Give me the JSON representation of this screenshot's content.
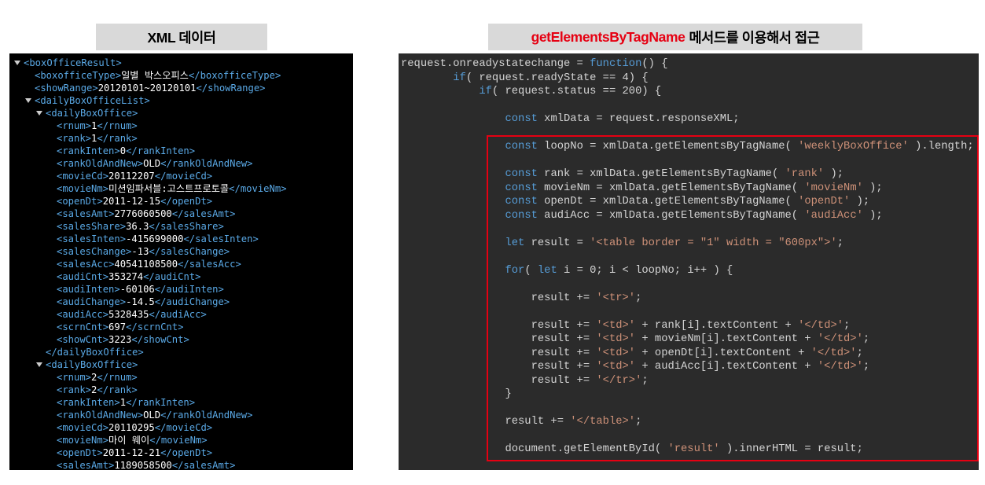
{
  "colors": {
    "header_bg": "#d9d9d9",
    "title_accent": "#e60012",
    "xml_bg": "#000000",
    "xml_tag": "#5aa9e6",
    "xml_text": "#ffffff",
    "xml_toggle": "#cccccc",
    "code_bg": "#2b2b2b",
    "code_text": "#d4d4d4",
    "code_keyword": "#569cd6",
    "code_string": "#ce9178",
    "highlight_border": "#e60012"
  },
  "xml_panel": {
    "title": "XML 데이터",
    "toggle_icon": "collapse-triangle-icon",
    "lines": [
      {
        "depth": 0,
        "toggle": true,
        "open": "<boxOfficeResult>"
      },
      {
        "depth": 1,
        "open": "<boxofficeType>",
        "value": "일별 박스오피스",
        "close": "</boxofficeType>"
      },
      {
        "depth": 1,
        "open": "<showRange>",
        "value": "20120101~20120101",
        "close": "</showRange>"
      },
      {
        "depth": 1,
        "toggle": true,
        "open": "<dailyBoxOfficeList>"
      },
      {
        "depth": 2,
        "toggle": true,
        "open": "<dailyBoxOffice>"
      },
      {
        "depth": 3,
        "open": "<rnum>",
        "value": "1",
        "close": "</rnum>"
      },
      {
        "depth": 3,
        "open": "<rank>",
        "value": "1",
        "close": "</rank>"
      },
      {
        "depth": 3,
        "open": "<rankInten>",
        "value": "0",
        "close": "</rankInten>"
      },
      {
        "depth": 3,
        "open": "<rankOldAndNew>",
        "value": "OLD",
        "close": "</rankOldAndNew>"
      },
      {
        "depth": 3,
        "open": "<movieCd>",
        "value": "20112207",
        "close": "</movieCd>"
      },
      {
        "depth": 3,
        "open": "<movieNm>",
        "value": "미션임파서블:고스트프로토콜",
        "close": "</movieNm>"
      },
      {
        "depth": 3,
        "open": "<openDt>",
        "value": "2011-12-15",
        "close": "</openDt>"
      },
      {
        "depth": 3,
        "open": "<salesAmt>",
        "value": "2776060500",
        "close": "</salesAmt>"
      },
      {
        "depth": 3,
        "open": "<salesShare>",
        "value": "36.3",
        "close": "</salesShare>"
      },
      {
        "depth": 3,
        "open": "<salesInten>",
        "value": "-415699000",
        "close": "</salesInten>"
      },
      {
        "depth": 3,
        "open": "<salesChange>",
        "value": "-13",
        "close": "</salesChange>"
      },
      {
        "depth": 3,
        "open": "<salesAcc>",
        "value": "40541108500",
        "close": "</salesAcc>"
      },
      {
        "depth": 3,
        "open": "<audiCnt>",
        "value": "353274",
        "close": "</audiCnt>"
      },
      {
        "depth": 3,
        "open": "<audiInten>",
        "value": "-60106",
        "close": "</audiInten>"
      },
      {
        "depth": 3,
        "open": "<audiChange>",
        "value": "-14.5",
        "close": "</audiChange>"
      },
      {
        "depth": 3,
        "open": "<audiAcc>",
        "value": "5328435",
        "close": "</audiAcc>"
      },
      {
        "depth": 3,
        "open": "<scrnCnt>",
        "value": "697",
        "close": "</scrnCnt>"
      },
      {
        "depth": 3,
        "open": "<showCnt>",
        "value": "3223",
        "close": "</showCnt>"
      },
      {
        "depth": 2,
        "close": "</dailyBoxOffice>"
      },
      {
        "depth": 2,
        "toggle": true,
        "open": "<dailyBoxOffice>"
      },
      {
        "depth": 3,
        "open": "<rnum>",
        "value": "2",
        "close": "</rnum>"
      },
      {
        "depth": 3,
        "open": "<rank>",
        "value": "2",
        "close": "</rank>"
      },
      {
        "depth": 3,
        "open": "<rankInten>",
        "value": "1",
        "close": "</rankInten>"
      },
      {
        "depth": 3,
        "open": "<rankOldAndNew>",
        "value": "OLD",
        "close": "</rankOldAndNew>"
      },
      {
        "depth": 3,
        "open": "<movieCd>",
        "value": "20110295",
        "close": "</movieCd>"
      },
      {
        "depth": 3,
        "open": "<movieNm>",
        "value": "마이 웨이",
        "close": "</movieNm>"
      },
      {
        "depth": 3,
        "open": "<openDt>",
        "value": "2011-12-21",
        "close": "</openDt>"
      },
      {
        "depth": 3,
        "open": "<salesAmt>",
        "value": "1189058500",
        "close": "</salesAmt>"
      }
    ]
  },
  "code_panel": {
    "title_method": "getElementsByTagName",
    "title_rest": "메서드를 이용해서 접근",
    "lines": [
      [
        {
          "t": "request.onreadystatechange = "
        },
        {
          "t": "function",
          "color": "#569cd6"
        },
        {
          "t": "() {"
        }
      ],
      [
        {
          "t": "        "
        },
        {
          "t": "if",
          "color": "#569cd6"
        },
        {
          "t": "( request.readyState == 4) {"
        }
      ],
      [
        {
          "t": "            "
        },
        {
          "t": "if",
          "color": "#569cd6"
        },
        {
          "t": "( request.status == 200) {"
        }
      ],
      [],
      [
        {
          "t": "                "
        },
        {
          "t": "const",
          "color": "#569cd6"
        },
        {
          "t": " xmlData = request.responseXML;"
        }
      ],
      [],
      [
        {
          "t": "                "
        },
        {
          "t": "const",
          "color": "#569cd6"
        },
        {
          "t": " loopNo = xmlData.getElementsByTagName( "
        },
        {
          "t": "'weeklyBoxOffice'",
          "color": "#ce9178"
        },
        {
          "t": " ).length;"
        }
      ],
      [],
      [
        {
          "t": "                "
        },
        {
          "t": "const",
          "color": "#569cd6"
        },
        {
          "t": " rank = xmlData.getElementsByTagName( "
        },
        {
          "t": "'rank'",
          "color": "#ce9178"
        },
        {
          "t": " );"
        }
      ],
      [
        {
          "t": "                "
        },
        {
          "t": "const",
          "color": "#569cd6"
        },
        {
          "t": " movieNm = xmlData.getElementsByTagName( "
        },
        {
          "t": "'movieNm'",
          "color": "#ce9178"
        },
        {
          "t": " );"
        }
      ],
      [
        {
          "t": "                "
        },
        {
          "t": "const",
          "color": "#569cd6"
        },
        {
          "t": " openDt = xmlData.getElementsByTagName( "
        },
        {
          "t": "'openDt'",
          "color": "#ce9178"
        },
        {
          "t": " );"
        }
      ],
      [
        {
          "t": "                "
        },
        {
          "t": "const",
          "color": "#569cd6"
        },
        {
          "t": " audiAcc = xmlData.getElementsByTagName( "
        },
        {
          "t": "'audiAcc'",
          "color": "#ce9178"
        },
        {
          "t": " );"
        }
      ],
      [],
      [
        {
          "t": "                "
        },
        {
          "t": "let",
          "color": "#569cd6"
        },
        {
          "t": " result = "
        },
        {
          "t": "'<table border = \"1\" width = \"600px\">'",
          "color": "#ce9178"
        },
        {
          "t": ";"
        }
      ],
      [],
      [
        {
          "t": "                "
        },
        {
          "t": "for",
          "color": "#569cd6"
        },
        {
          "t": "( "
        },
        {
          "t": "let",
          "color": "#569cd6"
        },
        {
          "t": " i = 0; i < loopNo; i++ ) {"
        }
      ],
      [],
      [
        {
          "t": "                    result += "
        },
        {
          "t": "'<tr>'",
          "color": "#ce9178"
        },
        {
          "t": ";"
        }
      ],
      [],
      [
        {
          "t": "                    result += "
        },
        {
          "t": "'<td>'",
          "color": "#ce9178"
        },
        {
          "t": " + rank[i].textContent + "
        },
        {
          "t": "'</td>'",
          "color": "#ce9178"
        },
        {
          "t": ";"
        }
      ],
      [
        {
          "t": "                    result += "
        },
        {
          "t": "'<td>'",
          "color": "#ce9178"
        },
        {
          "t": " + movieNm[i].textContent + "
        },
        {
          "t": "'</td>'",
          "color": "#ce9178"
        },
        {
          "t": ";"
        }
      ],
      [
        {
          "t": "                    result += "
        },
        {
          "t": "'<td>'",
          "color": "#ce9178"
        },
        {
          "t": " + openDt[i].textContent + "
        },
        {
          "t": "'</td>'",
          "color": "#ce9178"
        },
        {
          "t": ";"
        }
      ],
      [
        {
          "t": "                    result += "
        },
        {
          "t": "'<td>'",
          "color": "#ce9178"
        },
        {
          "t": " + audiAcc[i].textContent + "
        },
        {
          "t": "'</td>'",
          "color": "#ce9178"
        },
        {
          "t": ";"
        }
      ],
      [
        {
          "t": "                    result += "
        },
        {
          "t": "'</tr>'",
          "color": "#ce9178"
        },
        {
          "t": ";"
        }
      ],
      [
        {
          "t": "                }"
        }
      ],
      [],
      [
        {
          "t": "                result += "
        },
        {
          "t": "'</table>'",
          "color": "#ce9178"
        },
        {
          "t": ";"
        }
      ],
      [],
      [
        {
          "t": "                document.getElementById( "
        },
        {
          "t": "'result'",
          "color": "#ce9178"
        },
        {
          "t": " ).innerHTML = result;"
        }
      ]
    ]
  }
}
